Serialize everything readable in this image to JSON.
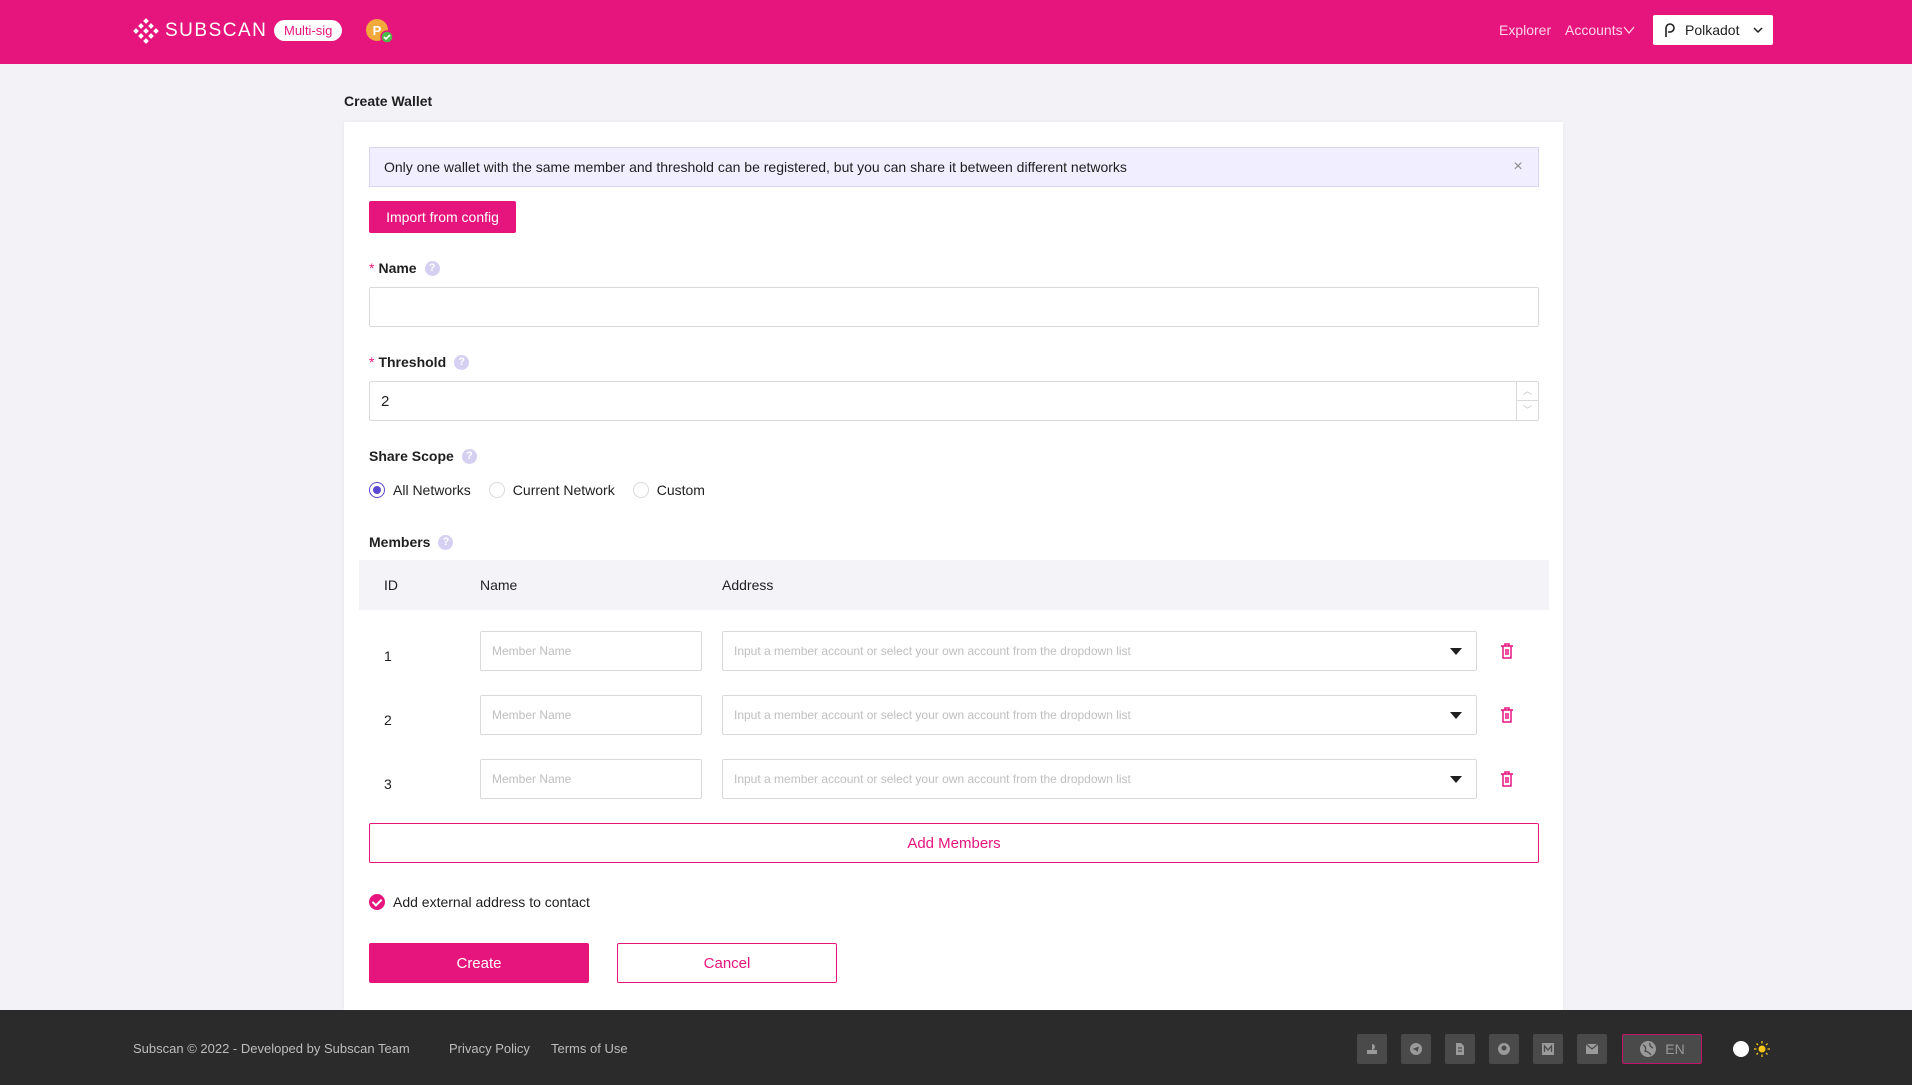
{
  "header": {
    "logo_text": "SUBSCAN",
    "badge": "Multi-sig",
    "nav_explorer": "Explorer",
    "nav_accounts": "Accounts",
    "network": "Polkadot",
    "brand_color": "#e6157d"
  },
  "page": {
    "title": "Create Wallet"
  },
  "alert": {
    "text": "Only one wallet with the same member and threshold can be registered, but you can share it between different networks"
  },
  "form": {
    "import_label": "Import from config",
    "name_label": "Name",
    "name_value": "",
    "threshold_label": "Threshold",
    "threshold_value": "2",
    "share_scope_label": "Share Scope",
    "share_options": [
      "All Networks",
      "Current Network",
      "Custom"
    ],
    "share_selected": "All Networks",
    "members_label": "Members",
    "columns": [
      "ID",
      "Name",
      "Address"
    ],
    "members": [
      {
        "id": "1",
        "name_placeholder": "Member Name",
        "address_placeholder": "Input a member account or select your own account from the dropdown list"
      },
      {
        "id": "2",
        "name_placeholder": "Member Name",
        "address_placeholder": "Input a member account or select your own account from the dropdown list"
      },
      {
        "id": "3",
        "name_placeholder": "Member Name",
        "address_placeholder": "Input a member account or select your own account from the dropdown list"
      }
    ],
    "add_members_label": "Add Members",
    "contact_checkbox_label": "Add external address to contact",
    "contact_checked": true,
    "create_label": "Create",
    "cancel_label": "Cancel"
  },
  "footer": {
    "copyright": "Subscan © 2022 - Developed by Subscan Team",
    "privacy": "Privacy Policy",
    "terms": "Terms of Use",
    "language": "EN",
    "social_icons": [
      "uservoice-icon",
      "telegram-icon",
      "element-icon",
      "github-icon",
      "medium-icon",
      "email-icon"
    ]
  }
}
